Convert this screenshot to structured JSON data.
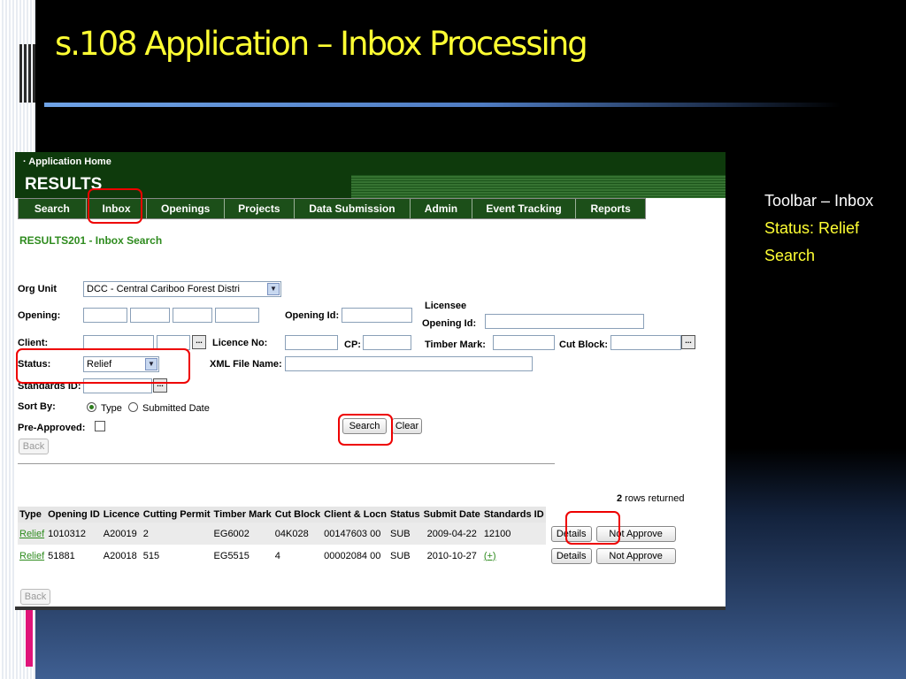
{
  "slide": {
    "title": "s.108 Application – Inbox Processing",
    "notes": [
      "Toolbar – Inbox",
      "Status: Relief",
      "Search"
    ]
  },
  "app": {
    "home_link": "· Application Home",
    "name": "RESULTS",
    "nav": [
      "Search",
      "Inbox",
      "Openings",
      "Projects",
      "Data Submission",
      "Admin",
      "Event Tracking",
      "Reports"
    ],
    "page_heading": "RESULTS201 - Inbox Search"
  },
  "form": {
    "org_unit_label": "Org Unit",
    "org_unit_value": "DCC - Central Cariboo Forest Distri",
    "opening_label": "Opening:",
    "opening_id_label": "Opening Id:",
    "licensee_label": "Licensee",
    "licensee_opening_id_label": "Opening Id:",
    "client_label": "Client:",
    "licence_no_label": "Licence No:",
    "cp_label": "CP:",
    "timber_mark_label": "Timber Mark:",
    "cut_block_label": "Cut Block:",
    "status_label": "Status:",
    "status_value": "Relief",
    "xml_file_label": "XML File Name:",
    "standards_id_label": "Standards ID:",
    "sort_by_label": "Sort By:",
    "sort_type": "Type",
    "sort_submitted": "Submitted Date",
    "pre_approved_label": "Pre-Approved:",
    "dots": "...",
    "search_btn": "Search",
    "clear_btn": "Clear",
    "back_btn": "Back"
  },
  "results": {
    "count": "2",
    "count_suffix": " rows returned",
    "columns": [
      "Type",
      "Opening ID",
      "Licence",
      "Cutting Permit",
      "Timber Mark",
      "Cut Block",
      "Client & Locn",
      "Status",
      "Submit Date",
      "Standards ID"
    ],
    "rows": [
      {
        "type": "Relief",
        "opening_id": "1010312",
        "licence": "A20019",
        "cp": "2",
        "timber_mark": "EG6002",
        "cut_block": "04K028",
        "client": "00147603 00",
        "status": "SUB",
        "submit_date": "2009-04-22",
        "standards_id": "12100"
      },
      {
        "type": "Relief",
        "opening_id": "51881",
        "licence": "A20018",
        "cp": "515",
        "timber_mark": "EG5515",
        "cut_block": "4",
        "client": "00002084 00",
        "status": "SUB",
        "submit_date": "2010-10-27",
        "standards_id": "(+)"
      }
    ],
    "details_btn": "Details",
    "not_approve_btn": "Not Approve",
    "back_btn": "Back"
  }
}
